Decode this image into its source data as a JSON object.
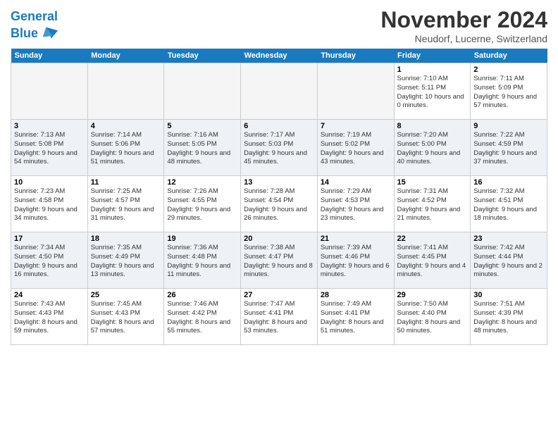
{
  "header": {
    "logo_line1": "General",
    "logo_line2": "Blue",
    "month": "November 2024",
    "location": "Neudorf, Lucerne, Switzerland"
  },
  "weekdays": [
    "Sunday",
    "Monday",
    "Tuesday",
    "Wednesday",
    "Thursday",
    "Friday",
    "Saturday"
  ],
  "weeks": [
    [
      {
        "day": "",
        "info": ""
      },
      {
        "day": "",
        "info": ""
      },
      {
        "day": "",
        "info": ""
      },
      {
        "day": "",
        "info": ""
      },
      {
        "day": "",
        "info": ""
      },
      {
        "day": "1",
        "info": "Sunrise: 7:10 AM\nSunset: 5:11 PM\nDaylight: 10 hours and 0 minutes."
      },
      {
        "day": "2",
        "info": "Sunrise: 7:11 AM\nSunset: 5:09 PM\nDaylight: 9 hours and 57 minutes."
      }
    ],
    [
      {
        "day": "3",
        "info": "Sunrise: 7:13 AM\nSunset: 5:08 PM\nDaylight: 9 hours and 54 minutes."
      },
      {
        "day": "4",
        "info": "Sunrise: 7:14 AM\nSunset: 5:06 PM\nDaylight: 9 hours and 51 minutes."
      },
      {
        "day": "5",
        "info": "Sunrise: 7:16 AM\nSunset: 5:05 PM\nDaylight: 9 hours and 48 minutes."
      },
      {
        "day": "6",
        "info": "Sunrise: 7:17 AM\nSunset: 5:03 PM\nDaylight: 9 hours and 45 minutes."
      },
      {
        "day": "7",
        "info": "Sunrise: 7:19 AM\nSunset: 5:02 PM\nDaylight: 9 hours and 43 minutes."
      },
      {
        "day": "8",
        "info": "Sunrise: 7:20 AM\nSunset: 5:00 PM\nDaylight: 9 hours and 40 minutes."
      },
      {
        "day": "9",
        "info": "Sunrise: 7:22 AM\nSunset: 4:59 PM\nDaylight: 9 hours and 37 minutes."
      }
    ],
    [
      {
        "day": "10",
        "info": "Sunrise: 7:23 AM\nSunset: 4:58 PM\nDaylight: 9 hours and 34 minutes."
      },
      {
        "day": "11",
        "info": "Sunrise: 7:25 AM\nSunset: 4:57 PM\nDaylight: 9 hours and 31 minutes."
      },
      {
        "day": "12",
        "info": "Sunrise: 7:26 AM\nSunset: 4:55 PM\nDaylight: 9 hours and 29 minutes."
      },
      {
        "day": "13",
        "info": "Sunrise: 7:28 AM\nSunset: 4:54 PM\nDaylight: 9 hours and 26 minutes."
      },
      {
        "day": "14",
        "info": "Sunrise: 7:29 AM\nSunset: 4:53 PM\nDaylight: 9 hours and 23 minutes."
      },
      {
        "day": "15",
        "info": "Sunrise: 7:31 AM\nSunset: 4:52 PM\nDaylight: 9 hours and 21 minutes."
      },
      {
        "day": "16",
        "info": "Sunrise: 7:32 AM\nSunset: 4:51 PM\nDaylight: 9 hours and 18 minutes."
      }
    ],
    [
      {
        "day": "17",
        "info": "Sunrise: 7:34 AM\nSunset: 4:50 PM\nDaylight: 9 hours and 16 minutes."
      },
      {
        "day": "18",
        "info": "Sunrise: 7:35 AM\nSunset: 4:49 PM\nDaylight: 9 hours and 13 minutes."
      },
      {
        "day": "19",
        "info": "Sunrise: 7:36 AM\nSunset: 4:48 PM\nDaylight: 9 hours and 11 minutes."
      },
      {
        "day": "20",
        "info": "Sunrise: 7:38 AM\nSunset: 4:47 PM\nDaylight: 9 hours and 8 minutes."
      },
      {
        "day": "21",
        "info": "Sunrise: 7:39 AM\nSunset: 4:46 PM\nDaylight: 9 hours and 6 minutes."
      },
      {
        "day": "22",
        "info": "Sunrise: 7:41 AM\nSunset: 4:45 PM\nDaylight: 9 hours and 4 minutes."
      },
      {
        "day": "23",
        "info": "Sunrise: 7:42 AM\nSunset: 4:44 PM\nDaylight: 9 hours and 2 minutes."
      }
    ],
    [
      {
        "day": "24",
        "info": "Sunrise: 7:43 AM\nSunset: 4:43 PM\nDaylight: 8 hours and 59 minutes."
      },
      {
        "day": "25",
        "info": "Sunrise: 7:45 AM\nSunset: 4:43 PM\nDaylight: 8 hours and 57 minutes."
      },
      {
        "day": "26",
        "info": "Sunrise: 7:46 AM\nSunset: 4:42 PM\nDaylight: 8 hours and 55 minutes."
      },
      {
        "day": "27",
        "info": "Sunrise: 7:47 AM\nSunset: 4:41 PM\nDaylight: 8 hours and 53 minutes."
      },
      {
        "day": "28",
        "info": "Sunrise: 7:49 AM\nSunset: 4:41 PM\nDaylight: 8 hours and 51 minutes."
      },
      {
        "day": "29",
        "info": "Sunrise: 7:50 AM\nSunset: 4:40 PM\nDaylight: 8 hours and 50 minutes."
      },
      {
        "day": "30",
        "info": "Sunrise: 7:51 AM\nSunset: 4:39 PM\nDaylight: 8 hours and 48 minutes."
      }
    ]
  ]
}
